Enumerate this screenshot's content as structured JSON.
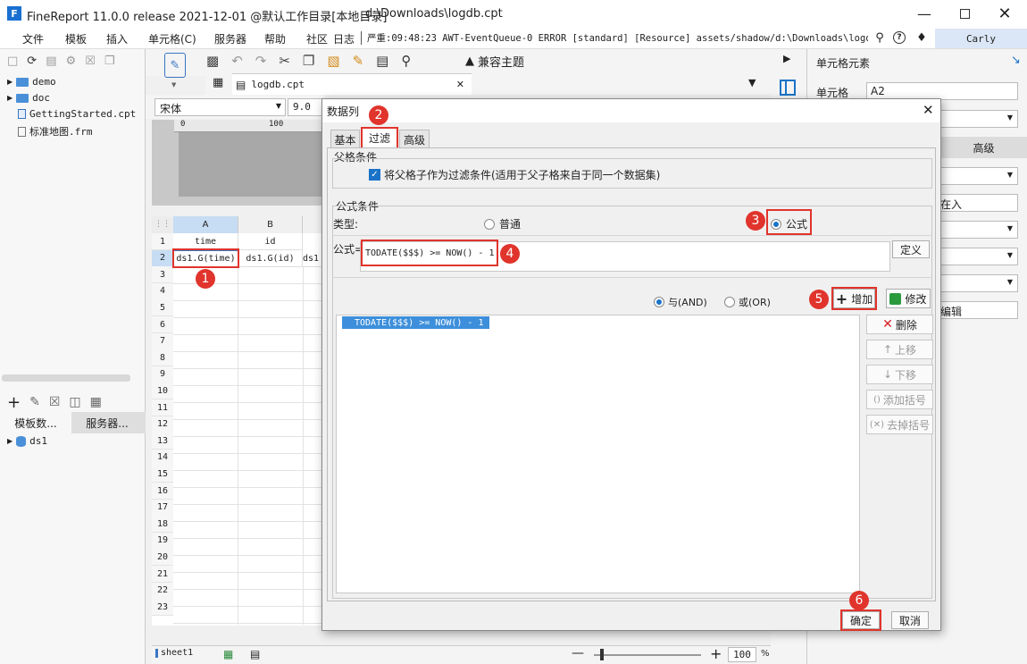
{
  "window": {
    "title": "FineReport 11.0.0 release 2021-12-01 @默认工作目录[本地目录]",
    "path": "d:\\Downloads\\logdb.cpt"
  },
  "menu": {
    "items": [
      "文件",
      "模板",
      "插入",
      "单元格(C)",
      "服务器",
      "帮助",
      "社区",
      "日志"
    ],
    "log_text": "严重:09:48:23 AWT-EventQueue-0 ERROR [standard] [Resource] assets/shadow/d:\\Downloads\\logd...",
    "user": "Carly"
  },
  "toolbar": {
    "compat_theme": "兼容主题"
  },
  "left_tree": {
    "items": [
      "demo",
      "doc",
      "GettingStarted.cpt",
      "标准地图.frm"
    ]
  },
  "left_bottom": {
    "tabs": [
      "模板数...",
      "服务器..."
    ],
    "dataset": "ds1"
  },
  "editor": {
    "tab_name": "logdb.cpt",
    "font": "宋体",
    "font_size": "9.0",
    "ruler_mark": "100",
    "columns": [
      "A",
      "B"
    ],
    "rows": [
      "1",
      "2",
      "3",
      "4",
      "5",
      "6",
      "7",
      "8",
      "9",
      "10",
      "11",
      "12",
      "13",
      "14",
      "15",
      "16",
      "17",
      "18",
      "19",
      "20",
      "21",
      "22",
      "23"
    ],
    "a1": "time",
    "b1": "id",
    "a2": "ds1.G(time)",
    "b2": "ds1.G(id)",
    "c2": "ds1",
    "sheet": "sheet1",
    "zoom": "100",
    "zoom_unit": "%"
  },
  "right_panel": {
    "title": "单元格元素",
    "cell_label": "单元格",
    "cell_value": "A2",
    "adv_label": "高级",
    "frag1": "在入",
    "frag2": "编辑"
  },
  "dialog": {
    "title": "数据列",
    "tabs": [
      "基本",
      "过滤",
      "高级"
    ],
    "parent_section": "父格条件",
    "parent_checkbox": "将父格子作为过滤条件(适用于父子格来自于同一个数据集)",
    "formula_section": "公式条件",
    "type_label": "类型:",
    "type_normal": "普通",
    "type_formula": "公式",
    "formula_label": "公式=",
    "formula_value": "TODATE($$$) >= NOW() - 1",
    "define_button": "定义",
    "and_label": "与(AND)",
    "or_label": "或(OR)",
    "add_button": "增加",
    "modify_button": "修改",
    "list_item": "TODATE($$$) >= NOW() - 1",
    "side_buttons": [
      "删除",
      "上移",
      "下移",
      "添加括号",
      "去掉括号"
    ],
    "ok_button": "确定",
    "cancel_button": "取消"
  },
  "badges": [
    "1",
    "2",
    "3",
    "4",
    "5",
    "6"
  ],
  "colors": {
    "accent": "#1a73c8",
    "highlight": "#e0342c",
    "selection": "#3d8fdb"
  }
}
